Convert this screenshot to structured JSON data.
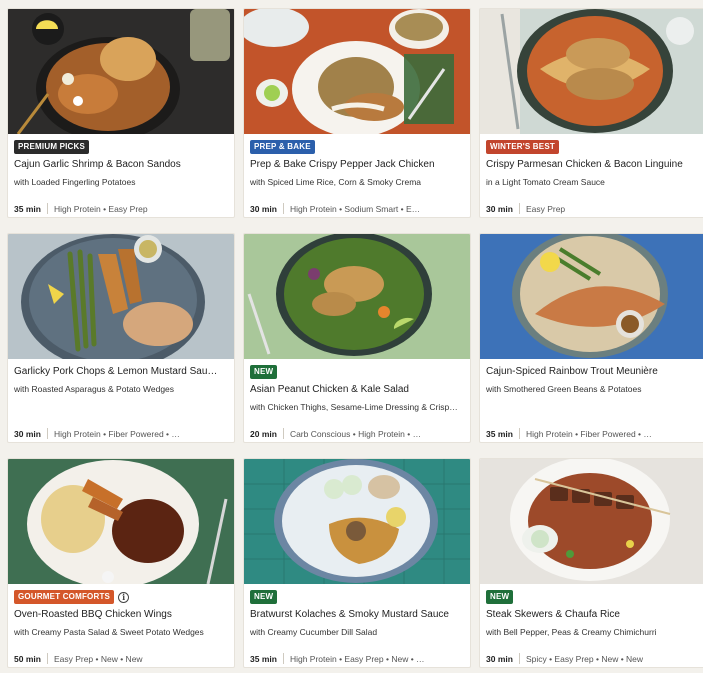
{
  "colors": {
    "badge_dark": "#2b2b2b",
    "badge_blue": "#2b5fab",
    "badge_red": "#c2452d",
    "badge_green": "#1f6f3a",
    "badge_orange": "#d4572a"
  },
  "cards": [
    {
      "badge": "PREMIUM PICKS",
      "badge_color": "#2b2b2b",
      "title": "Cajun Garlic Shrimp & Bacon Sandos",
      "subtitle": "with Loaded Fingerling Potatoes",
      "time": "35 min",
      "tags": "High Protein • Easy Prep",
      "info_icon": false
    },
    {
      "badge": "PREP & BAKE",
      "badge_color": "#2b5fab",
      "title": "Prep & Bake Crispy Pepper Jack Chicken",
      "subtitle": "with Spiced Lime Rice, Corn & Smoky Crema",
      "time": "30 min",
      "tags": "High Protein • Sodium Smart • E…",
      "info_icon": false
    },
    {
      "badge": "WINTER'S BEST",
      "badge_color": "#c2452d",
      "title": "Crispy Parmesan Chicken & Bacon Linguine",
      "subtitle": "in a Light Tomato Cream Sauce",
      "time": "30 min",
      "tags": "Easy Prep",
      "info_icon": false
    },
    {
      "badge": "",
      "badge_color": "",
      "title": "Garlicky Pork Chops & Lemon Mustard Sau…",
      "subtitle": "with Roasted Asparagus & Potato Wedges",
      "time": "30 min",
      "tags": "High Protein • Fiber Powered • …",
      "info_icon": false
    },
    {
      "badge": "NEW",
      "badge_color": "#1f6f3a",
      "title": "Asian Peanut Chicken & Kale Salad",
      "subtitle": "with Chicken Thighs, Sesame-Lime Dressing & Crisp…",
      "time": "20 min",
      "tags": "Carb Conscious • High Protein • …",
      "info_icon": false
    },
    {
      "badge": "",
      "badge_color": "",
      "title": "Cajun-Spiced Rainbow Trout Meunière",
      "subtitle": "with Smothered Green Beans & Potatoes",
      "time": "35 min",
      "tags": "High Protein • Fiber Powered • …",
      "info_icon": false
    },
    {
      "badge": "GOURMET COMFORTS",
      "badge_color": "#d4572a",
      "title": "Oven-Roasted BBQ Chicken Wings",
      "subtitle": "with Creamy Pasta Salad & Sweet Potato Wedges",
      "time": "50 min",
      "tags": "Easy Prep • New • New",
      "info_icon": true
    },
    {
      "badge": "NEW",
      "badge_color": "#1f6f3a",
      "title": "Bratwurst Kolaches & Smoky Mustard Sauce",
      "subtitle": "with Creamy Cucumber Dill Salad",
      "time": "35 min",
      "tags": "High Protein • Easy Prep • New • …",
      "info_icon": false
    },
    {
      "badge": "NEW",
      "badge_color": "#1f6f3a",
      "title": "Steak Skewers & Chaufa Rice",
      "subtitle": "with Bell Pepper, Peas & Creamy Chimichurri",
      "time": "30 min",
      "tags": "Spicy • Easy Prep • New • New",
      "info_icon": false
    }
  ],
  "icons": {
    "info": "info-icon"
  }
}
